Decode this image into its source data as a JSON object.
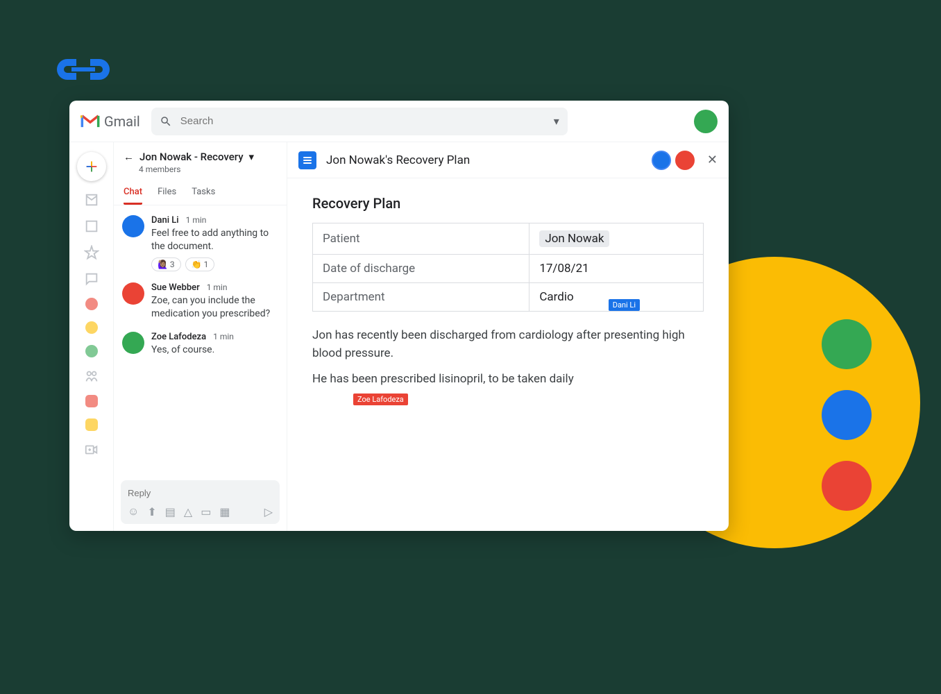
{
  "app": {
    "name": "Gmail"
  },
  "search": {
    "placeholder": "Search"
  },
  "chat": {
    "title": "Jon Nowak - Recovery",
    "members": "4 members",
    "tabs": {
      "chat": "Chat",
      "files": "Files",
      "tasks": "Tasks"
    },
    "messages": [
      {
        "sender": "Dani Li",
        "time": "1 min",
        "body": "Feel free to add anything to the document.",
        "avatar_color": "#1a73e8",
        "reactions": [
          {
            "emoji": "🙋🏽‍♀️",
            "count": "3"
          },
          {
            "emoji": "👏",
            "count": "1"
          }
        ]
      },
      {
        "sender": "Sue Webber",
        "time": "1 min",
        "body": "Zoe, can you include the medication you prescribed?",
        "avatar_color": "#ea4335",
        "reactions": []
      },
      {
        "sender": "Zoe Lafodeza",
        "time": "1 min",
        "body": "Yes, of course.",
        "avatar_color": "#34a853",
        "reactions": []
      }
    ],
    "reply_placeholder": "Reply"
  },
  "doc": {
    "title": "Jon Nowak's Recovery Plan",
    "heading": "Recovery Plan",
    "table": {
      "rows": [
        {
          "label": "Patient",
          "value": "Jon Nowak",
          "highlight": true
        },
        {
          "label": "Date of discharge",
          "value": "17/08/21",
          "highlight": false
        },
        {
          "label": "Department",
          "value": "Cardio",
          "highlight": false
        }
      ]
    },
    "paragraphs": [
      "Jon has recently been discharged from cardiology after presenting high blood pressure.",
      "He has been prescribed lisinopril, to be taken daily"
    ],
    "cursors": {
      "blue": "Dani Li",
      "red": "Zoe Lafodeza"
    }
  }
}
